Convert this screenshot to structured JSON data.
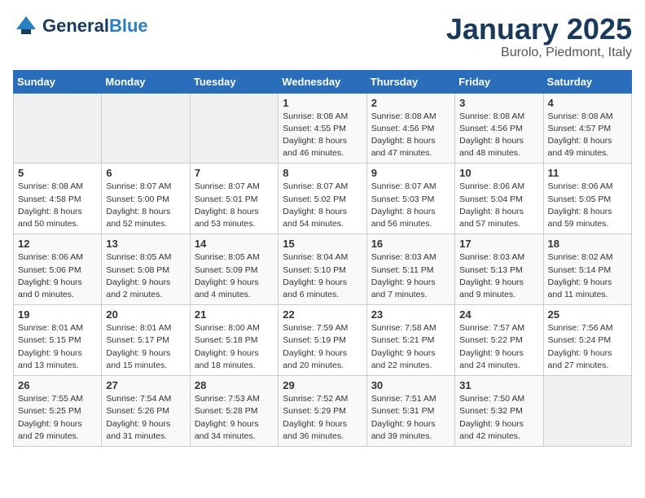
{
  "header": {
    "logo_general": "General",
    "logo_blue": "Blue",
    "month_title": "January 2025",
    "subtitle": "Burolo, Piedmont, Italy"
  },
  "weekdays": [
    "Sunday",
    "Monday",
    "Tuesday",
    "Wednesday",
    "Thursday",
    "Friday",
    "Saturday"
  ],
  "weeks": [
    [
      {
        "day": "",
        "info": ""
      },
      {
        "day": "",
        "info": ""
      },
      {
        "day": "",
        "info": ""
      },
      {
        "day": "1",
        "info": "Sunrise: 8:08 AM\nSunset: 4:55 PM\nDaylight: 8 hours\nand 46 minutes."
      },
      {
        "day": "2",
        "info": "Sunrise: 8:08 AM\nSunset: 4:56 PM\nDaylight: 8 hours\nand 47 minutes."
      },
      {
        "day": "3",
        "info": "Sunrise: 8:08 AM\nSunset: 4:56 PM\nDaylight: 8 hours\nand 48 minutes."
      },
      {
        "day": "4",
        "info": "Sunrise: 8:08 AM\nSunset: 4:57 PM\nDaylight: 8 hours\nand 49 minutes."
      }
    ],
    [
      {
        "day": "5",
        "info": "Sunrise: 8:08 AM\nSunset: 4:58 PM\nDaylight: 8 hours\nand 50 minutes."
      },
      {
        "day": "6",
        "info": "Sunrise: 8:07 AM\nSunset: 5:00 PM\nDaylight: 8 hours\nand 52 minutes."
      },
      {
        "day": "7",
        "info": "Sunrise: 8:07 AM\nSunset: 5:01 PM\nDaylight: 8 hours\nand 53 minutes."
      },
      {
        "day": "8",
        "info": "Sunrise: 8:07 AM\nSunset: 5:02 PM\nDaylight: 8 hours\nand 54 minutes."
      },
      {
        "day": "9",
        "info": "Sunrise: 8:07 AM\nSunset: 5:03 PM\nDaylight: 8 hours\nand 56 minutes."
      },
      {
        "day": "10",
        "info": "Sunrise: 8:06 AM\nSunset: 5:04 PM\nDaylight: 8 hours\nand 57 minutes."
      },
      {
        "day": "11",
        "info": "Sunrise: 8:06 AM\nSunset: 5:05 PM\nDaylight: 8 hours\nand 59 minutes."
      }
    ],
    [
      {
        "day": "12",
        "info": "Sunrise: 8:06 AM\nSunset: 5:06 PM\nDaylight: 9 hours\nand 0 minutes."
      },
      {
        "day": "13",
        "info": "Sunrise: 8:05 AM\nSunset: 5:08 PM\nDaylight: 9 hours\nand 2 minutes."
      },
      {
        "day": "14",
        "info": "Sunrise: 8:05 AM\nSunset: 5:09 PM\nDaylight: 9 hours\nand 4 minutes."
      },
      {
        "day": "15",
        "info": "Sunrise: 8:04 AM\nSunset: 5:10 PM\nDaylight: 9 hours\nand 6 minutes."
      },
      {
        "day": "16",
        "info": "Sunrise: 8:03 AM\nSunset: 5:11 PM\nDaylight: 9 hours\nand 7 minutes."
      },
      {
        "day": "17",
        "info": "Sunrise: 8:03 AM\nSunset: 5:13 PM\nDaylight: 9 hours\nand 9 minutes."
      },
      {
        "day": "18",
        "info": "Sunrise: 8:02 AM\nSunset: 5:14 PM\nDaylight: 9 hours\nand 11 minutes."
      }
    ],
    [
      {
        "day": "19",
        "info": "Sunrise: 8:01 AM\nSunset: 5:15 PM\nDaylight: 9 hours\nand 13 minutes."
      },
      {
        "day": "20",
        "info": "Sunrise: 8:01 AM\nSunset: 5:17 PM\nDaylight: 9 hours\nand 15 minutes."
      },
      {
        "day": "21",
        "info": "Sunrise: 8:00 AM\nSunset: 5:18 PM\nDaylight: 9 hours\nand 18 minutes."
      },
      {
        "day": "22",
        "info": "Sunrise: 7:59 AM\nSunset: 5:19 PM\nDaylight: 9 hours\nand 20 minutes."
      },
      {
        "day": "23",
        "info": "Sunrise: 7:58 AM\nSunset: 5:21 PM\nDaylight: 9 hours\nand 22 minutes."
      },
      {
        "day": "24",
        "info": "Sunrise: 7:57 AM\nSunset: 5:22 PM\nDaylight: 9 hours\nand 24 minutes."
      },
      {
        "day": "25",
        "info": "Sunrise: 7:56 AM\nSunset: 5:24 PM\nDaylight: 9 hours\nand 27 minutes."
      }
    ],
    [
      {
        "day": "26",
        "info": "Sunrise: 7:55 AM\nSunset: 5:25 PM\nDaylight: 9 hours\nand 29 minutes."
      },
      {
        "day": "27",
        "info": "Sunrise: 7:54 AM\nSunset: 5:26 PM\nDaylight: 9 hours\nand 31 minutes."
      },
      {
        "day": "28",
        "info": "Sunrise: 7:53 AM\nSunset: 5:28 PM\nDaylight: 9 hours\nand 34 minutes."
      },
      {
        "day": "29",
        "info": "Sunrise: 7:52 AM\nSunset: 5:29 PM\nDaylight: 9 hours\nand 36 minutes."
      },
      {
        "day": "30",
        "info": "Sunrise: 7:51 AM\nSunset: 5:31 PM\nDaylight: 9 hours\nand 39 minutes."
      },
      {
        "day": "31",
        "info": "Sunrise: 7:50 AM\nSunset: 5:32 PM\nDaylight: 9 hours\nand 42 minutes."
      },
      {
        "day": "",
        "info": ""
      }
    ]
  ]
}
